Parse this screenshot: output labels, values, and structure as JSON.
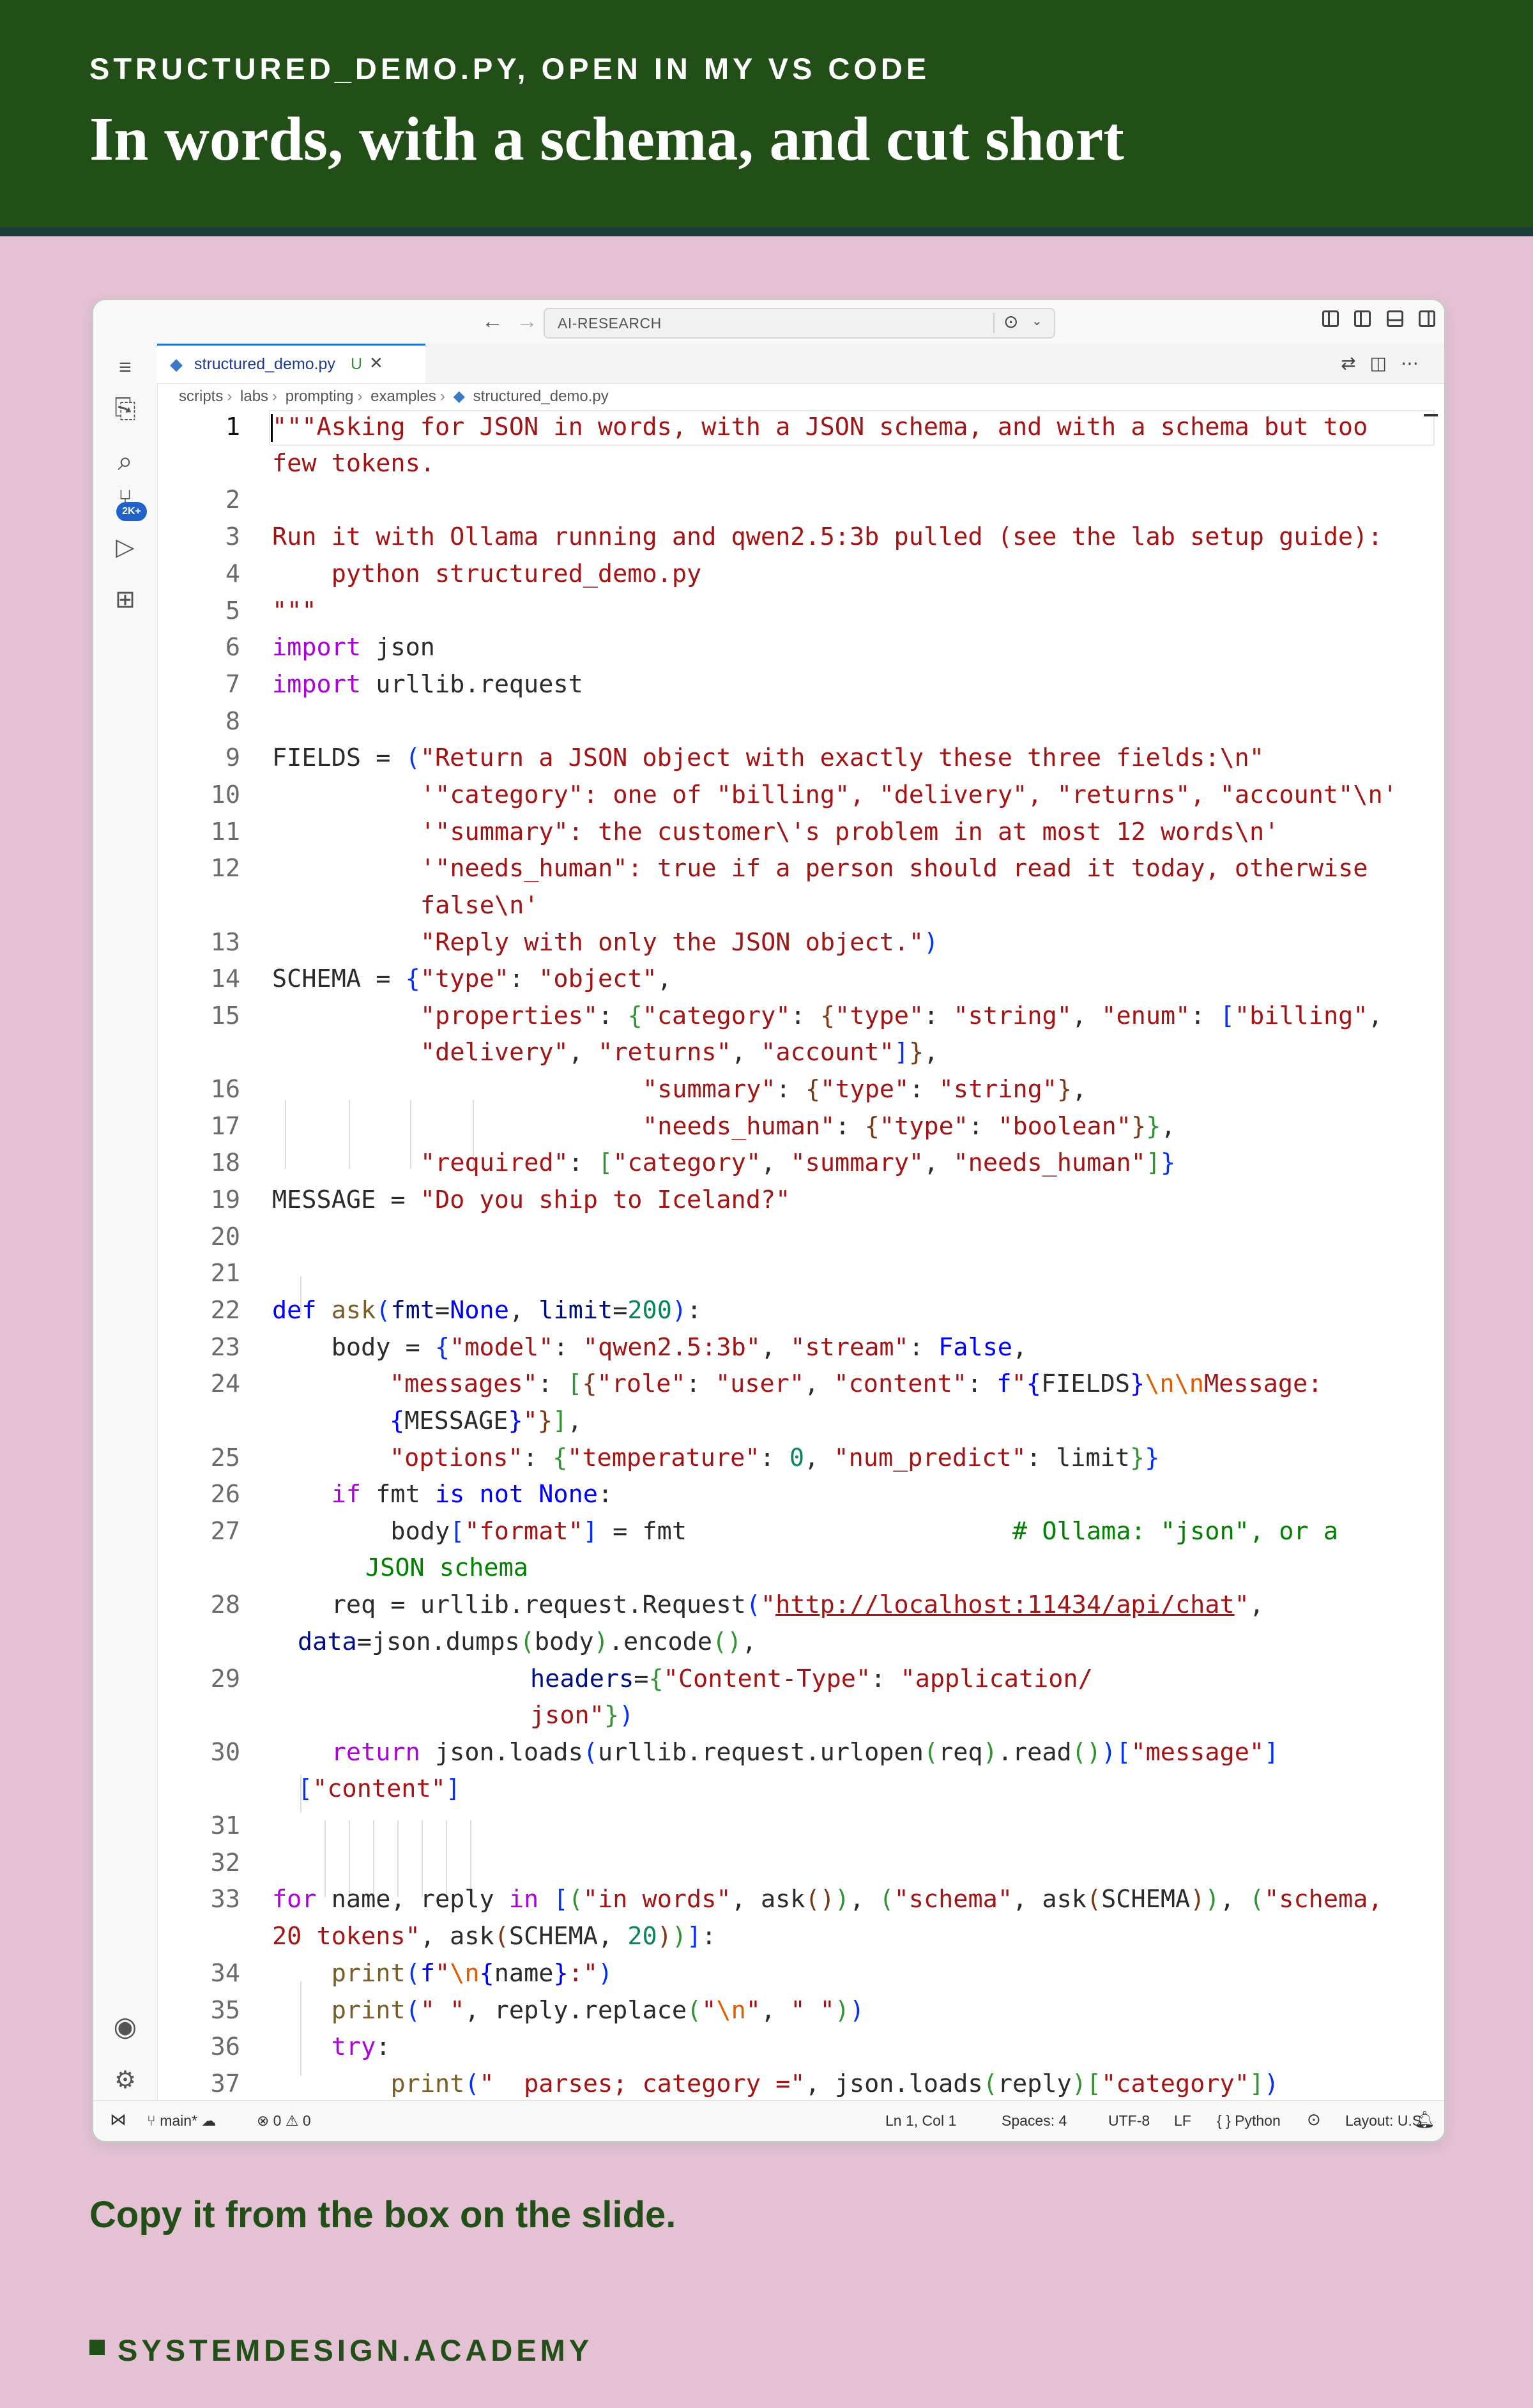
{
  "slide": {
    "kicker": "STRUCTURED_DEMO.PY, OPEN IN MY VS CODE",
    "title": "In words, with a schema, and cut short",
    "caption": "Copy it from the box on the slide.",
    "brand": "SYSTEMDESIGN.ACADEMY",
    "colors": {
      "banner": "#224e18",
      "background": "#e4c2d4",
      "accent": "#224e18"
    }
  },
  "editor": {
    "command_center": "AI-RESEARCH",
    "tab": {
      "label": "structured_demo.py",
      "status": "U"
    },
    "breadcrumb": [
      "scripts",
      "labs",
      "prompting",
      "examples",
      "structured_demo.py"
    ],
    "line_numbers": [
      "1",
      "2",
      "3",
      "4",
      "5",
      "6",
      "7",
      "8",
      "9",
      "10",
      "11",
      "12",
      "13",
      "14",
      "15",
      "16",
      "17",
      "18",
      "19",
      "20",
      "21",
      "22",
      "23",
      "24",
      "25",
      "26",
      "27",
      "28",
      "29",
      "30",
      "31",
      "32",
      "33",
      "34",
      "35",
      "36",
      "37"
    ],
    "code": {
      "l1a": "\"\"\"Asking for JSON in words, with a JSON schema, and with a schema but too",
      "l1b": "few tokens.",
      "l3": "Run it with Ollama running and qwen2.5:3b pulled (see the lab setup guide):",
      "l4": "    python structured_demo.py",
      "l5": "\"\"\"",
      "l6": "json",
      "l7": "urllib.request",
      "l9": "\"Return a JSON object with exactly these three fields:\\n\"",
      "l10": "'\"category\": one of \"billing\", \"delivery\", \"returns\", \"account\"\\n'",
      "l11": "'\"summary\": the customer\\'s problem in at most 12 words\\n'",
      "l12a": "'\"needs_human\": true if a person should read it today, otherwise",
      "l12b": "false\\n'",
      "l13": "\"Reply with only the JSON object.\"",
      "l19": "\"Do you ship to Iceland?\"",
      "l27_comment": "# Ollama: \"json\", or a",
      "l27b": "JSON schema",
      "url": "http://localhost:11434/api/chat"
    },
    "status": {
      "branch": "main*",
      "problems": "0",
      "warnings": "0",
      "position": "Ln 1, Col 1",
      "spaces": "Spaces: 4",
      "encoding": "UTF-8",
      "eol": "LF",
      "language": "Python",
      "layout": "Layout: U.S."
    }
  },
  "icons": [
    "menu-icon",
    "explorer-icon",
    "search-icon",
    "source-control-icon",
    "run-debug-icon",
    "extensions-icon",
    "account-icon",
    "settings-icon",
    "python-file-icon",
    "close-icon",
    "bell-icon"
  ],
  "badges": {
    "source_control": "2K+"
  }
}
